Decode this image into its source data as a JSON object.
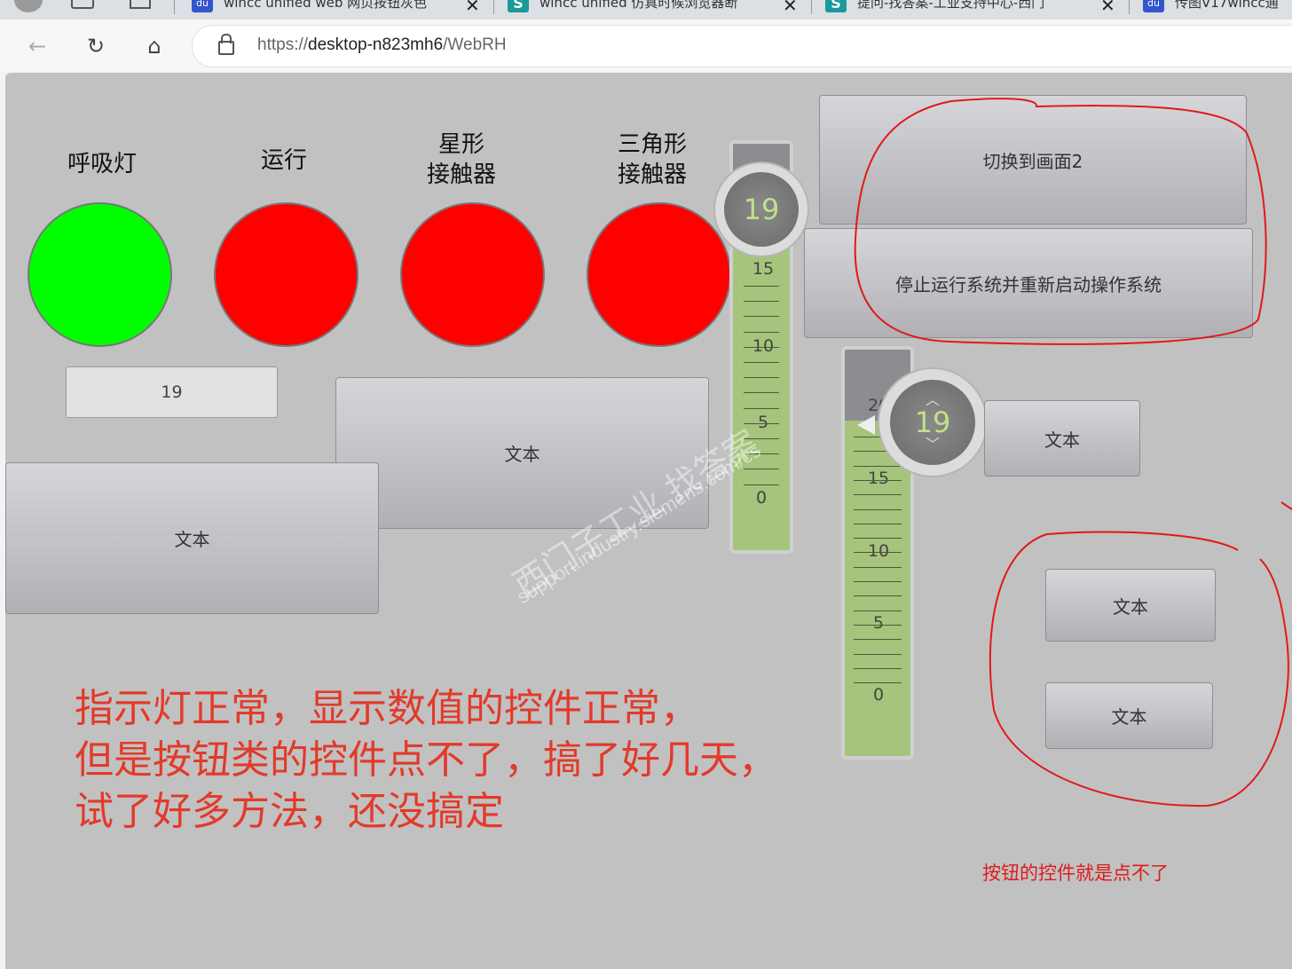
{
  "browser": {
    "tabs": [
      {
        "title": "wincc unified web 网页按钮灰色",
        "icon": "b"
      },
      {
        "title": "wincc unified 仿真时候浏览器断",
        "icon": "S"
      },
      {
        "title": "提问-找答案-工业支持中心-西门",
        "icon": "S"
      },
      {
        "title": "传图V17wincc通",
        "icon": "b"
      }
    ],
    "url_prefix": "https://",
    "url_host": "desktop-n823mh6",
    "url_path": "/WebRH"
  },
  "hmi": {
    "lamps": [
      {
        "label": "呼吸灯",
        "color": "#00ff00"
      },
      {
        "label": "运行",
        "color": "#ff0000"
      },
      {
        "label": "星形\n接触器",
        "color": "#ff0000"
      },
      {
        "label": "三角形\n接触器",
        "color": "#ff0000"
      }
    ],
    "io_field_value": "19",
    "button_switch_screen": "切换到画面2",
    "button_stop_runtime": "停止运行系统并重新启动操作系统",
    "button_text_1": "文本",
    "button_text_2": "文本",
    "button_text_3": "文本",
    "button_text_4": "文本",
    "button_text_5": "文本",
    "slider1": {
      "value": "19",
      "ticks": [
        "15",
        "10",
        "5",
        "0"
      ]
    },
    "slider2": {
      "value": "19",
      "ticks": [
        "20",
        "15",
        "10",
        "5",
        "0"
      ]
    },
    "watermark_cn": "西门子工业  找答案",
    "watermark_en": "support.industry.siemens.com/cs"
  },
  "annotations": {
    "note_lines": [
      "指示灯正常，显示数值的控件正常，",
      "但是按钮类的控件点不了，搞了好几天，",
      "试了好多方法，还没搞定"
    ],
    "note_small": "按钮的控件就是点不了",
    "circle_color": "#e01a1a"
  }
}
